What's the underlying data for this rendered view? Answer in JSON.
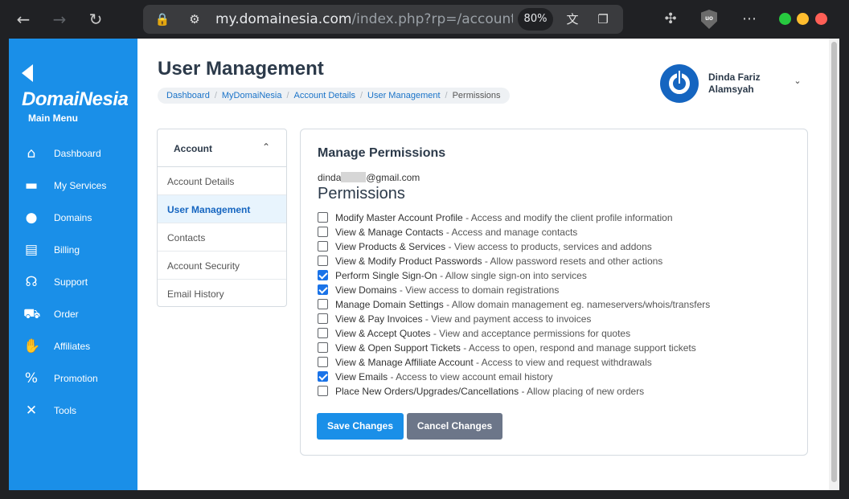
{
  "browser": {
    "url_host": "my.domainesia.com",
    "url_path": "/index.php?rp=/account/use",
    "zoom": "80%"
  },
  "sidebar": {
    "logo": "DomaiNesia",
    "main_menu_label": "Main Menu",
    "items": [
      {
        "label": "Dashboard",
        "icon": "home-icon"
      },
      {
        "label": "My Services",
        "icon": "server-icon"
      },
      {
        "label": "Domains",
        "icon": "globe-icon"
      },
      {
        "label": "Billing",
        "icon": "receipt-icon"
      },
      {
        "label": "Support",
        "icon": "headset-icon"
      },
      {
        "label": "Order",
        "icon": "cart-icon"
      },
      {
        "label": "Affiliates",
        "icon": "handshake-icon"
      },
      {
        "label": "Promotion",
        "icon": "percent-icon"
      },
      {
        "label": "Tools",
        "icon": "tools-icon"
      }
    ]
  },
  "header": {
    "title": "User Management",
    "breadcrumb": [
      "Dashboard",
      "MyDomaiNesia",
      "Account Details",
      "User Management",
      "Permissions"
    ],
    "user_name_line1": "Dinda Fariz",
    "user_name_line2": "Alamsyah"
  },
  "account_menu": {
    "title": "Account",
    "items": [
      "Account Details",
      "User Management",
      "Contacts",
      "Account Security",
      "Email History"
    ],
    "active_index": 1
  },
  "permissions": {
    "heading": "Manage Permissions",
    "email_prefix": "dinda",
    "email_suffix": "@gmail.com",
    "subtitle": "Permissions",
    "items": [
      {
        "name": "Modify Master Account Profile",
        "desc": " - Access and modify the client profile information",
        "checked": false
      },
      {
        "name": "View & Manage Contacts",
        "desc": " - Access and manage contacts",
        "checked": false
      },
      {
        "name": "View Products & Services",
        "desc": " - View access to products, services and addons",
        "checked": false
      },
      {
        "name": "View & Modify Product Passwords",
        "desc": " - Allow password resets and other actions",
        "checked": false
      },
      {
        "name": "Perform Single Sign-On",
        "desc": " - Allow single sign-on into services",
        "checked": true
      },
      {
        "name": "View Domains",
        "desc": " - View access to domain registrations",
        "checked": true
      },
      {
        "name": "Manage Domain Settings",
        "desc": " - Allow domain management eg. nameservers/whois/transfers",
        "checked": false
      },
      {
        "name": "View & Pay Invoices",
        "desc": " - View and payment access to invoices",
        "checked": false
      },
      {
        "name": "View & Accept Quotes",
        "desc": " - View and acceptance permissions for quotes",
        "checked": false
      },
      {
        "name": "View & Open Support Tickets",
        "desc": " - Access to open, respond and manage support tickets",
        "checked": false
      },
      {
        "name": "View & Manage Affiliate Account",
        "desc": " - Access to view and request withdrawals",
        "checked": false
      },
      {
        "name": "View Emails",
        "desc": " - Access to view account email history",
        "checked": true
      },
      {
        "name": "Place New Orders/Upgrades/Cancellations",
        "desc": " - Allow placing of new orders",
        "checked": false
      }
    ],
    "save_label": "Save Changes",
    "cancel_label": "Cancel Changes"
  },
  "colors": {
    "sidebar": "#1a8fe8",
    "primary_button": "#1a8fe8",
    "secondary_button": "#6c7689",
    "checkbox_checked": "#1a73e8"
  }
}
